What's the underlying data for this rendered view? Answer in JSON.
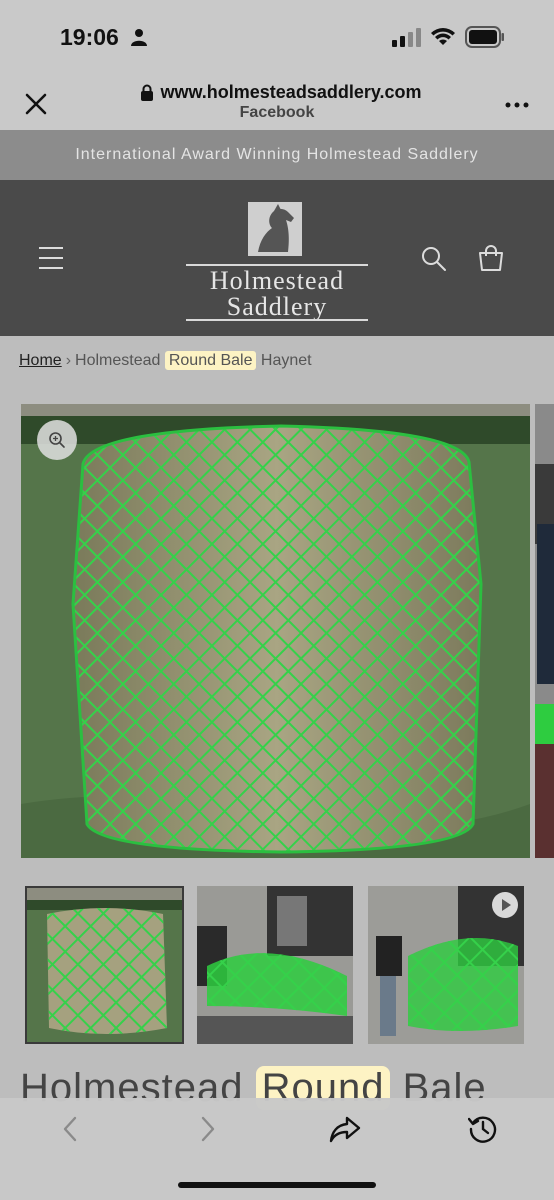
{
  "status_bar": {
    "time": "19:06"
  },
  "browser": {
    "url": "www.holmesteadsaddlery.com",
    "source": "Facebook"
  },
  "announcement": {
    "text": "International Award Winning Holmestead Saddlery"
  },
  "logo": {
    "line1": "Holmestead",
    "line2": "Saddlery"
  },
  "breadcrumb": {
    "home": "Home",
    "separator": "›",
    "current_before": "Holmestead",
    "current_highlight": "Round Bale",
    "current_after": "Haynet"
  },
  "product": {
    "title_before": "Holmestead",
    "title_highlight": "Round",
    "title_after": "Bale"
  },
  "icons": {
    "status": [
      "person-icon",
      "signal-icon",
      "wifi-icon",
      "battery-icon"
    ],
    "header": [
      "menu-icon",
      "search-icon",
      "cart-icon"
    ],
    "browser": [
      "close-icon",
      "lock-icon",
      "more-icon"
    ],
    "media": [
      "zoom-icon",
      "play-icon"
    ],
    "toolbar": [
      "back-icon",
      "forward-icon",
      "share-icon",
      "history-icon"
    ]
  },
  "colors": {
    "announcement_bg": "#8c8c8c",
    "header_bg": "#4a4a4a",
    "net_green": "#2ecc40",
    "highlight": "#fdf3c4"
  }
}
